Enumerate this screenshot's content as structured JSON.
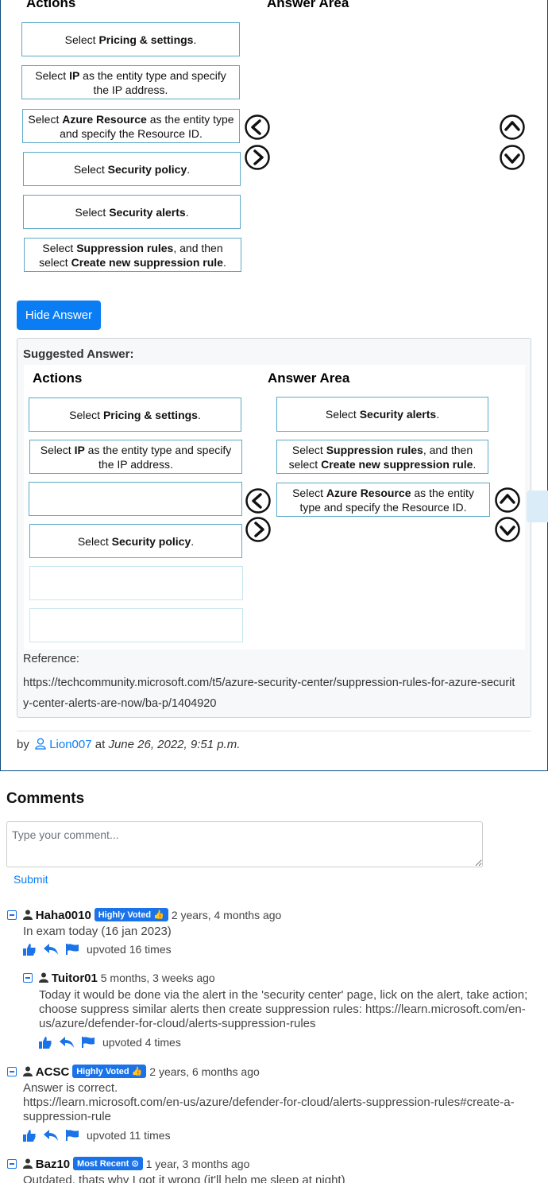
{
  "question": {
    "actions_header": "Actions",
    "answer_area_header": "Answer Area",
    "actions": [
      {
        "pre": "Select ",
        "bold": "Pricing & settings",
        "post": "."
      },
      {
        "pre": "Select ",
        "bold": "IP",
        "post": " as the entity type and specify the IP address."
      },
      {
        "pre": "Select ",
        "bold": "Azure Resource",
        "post": " as the entity type and specify the Resource ID."
      },
      {
        "pre": "Select ",
        "bold": "Security policy",
        "post": "."
      },
      {
        "pre": "Select ",
        "bold": "Security alerts",
        "post": "."
      },
      {
        "pre": "Select ",
        "bold": "Suppression rules",
        "mid": ", and then select ",
        "bold2": "Create new suppression rule",
        "post": "."
      }
    ]
  },
  "hide_answer_button": "Hide Answer",
  "suggested": {
    "label": "Suggested Answer:",
    "actions_header": "Actions",
    "answer_area_header": "Answer Area",
    "actions": [
      {
        "pre": "Select ",
        "bold": "Pricing & settings",
        "post": "."
      },
      {
        "pre": "Select ",
        "bold": "IP",
        "post": " as the entity type and specify the IP address."
      },
      {
        "pre": "Select ",
        "bold": "Security policy",
        "post": "."
      }
    ],
    "answers": [
      {
        "pre": "Select ",
        "bold": "Security alerts",
        "post": "."
      },
      {
        "pre": "Select ",
        "bold": "Suppression rules",
        "mid": ", and then select ",
        "bold2": "Create new suppression rule",
        "post": "."
      },
      {
        "pre": "Select ",
        "bold": "Azure Resource",
        "post": " as the entity type and specify the Resource ID."
      }
    ],
    "reference_label": "Reference:",
    "reference_url": "https://techcommunity.microsoft.com/t5/azure-security-center/suppression-rules-for-azure-security-center-alerts-are-now/ba-p/1404920"
  },
  "byline": {
    "by": "by",
    "author": "Lion007",
    "at": "at",
    "date": "June 26, 2022, 9:51 p.m."
  },
  "comments": {
    "title": "Comments",
    "placeholder": "Type your comment...",
    "submit": "Submit",
    "items": [
      {
        "user": "Haha0010",
        "badge": "Highly Voted",
        "ago": "2 years, 4 months ago",
        "text": "In exam today (16 jan 2023)",
        "votes": "upvoted 16 times"
      },
      {
        "user": "Tuitor01",
        "badge": "",
        "ago": "5 months, 3 weeks ago",
        "text": "Today it would be done via the alert in the 'security center' page, lick on the alert, take action; choose suppress similar alerts then create suppression rules: https://learn.microsoft.com/en-us/azure/defender-for-cloud/alerts-suppression-rules",
        "votes": "upvoted 4 times"
      },
      {
        "user": "ACSC",
        "badge": "Highly Voted",
        "ago": "2 years, 6 months ago",
        "text": "Answer is correct.\nhttps://learn.microsoft.com/en-us/azure/defender-for-cloud/alerts-suppression-rules#create-a-suppression-rule",
        "votes": "upvoted 11 times"
      },
      {
        "user": "Baz10",
        "badge": "Most Recent",
        "ago": "1 year, 3 months ago",
        "text": "Outdated, thats why I got it wrong (it'll help me sleep at night)"
      }
    ]
  },
  "colors": {
    "accent": "#0a7df5",
    "border": "#5aa9c8",
    "badge": "#1a73e8"
  }
}
